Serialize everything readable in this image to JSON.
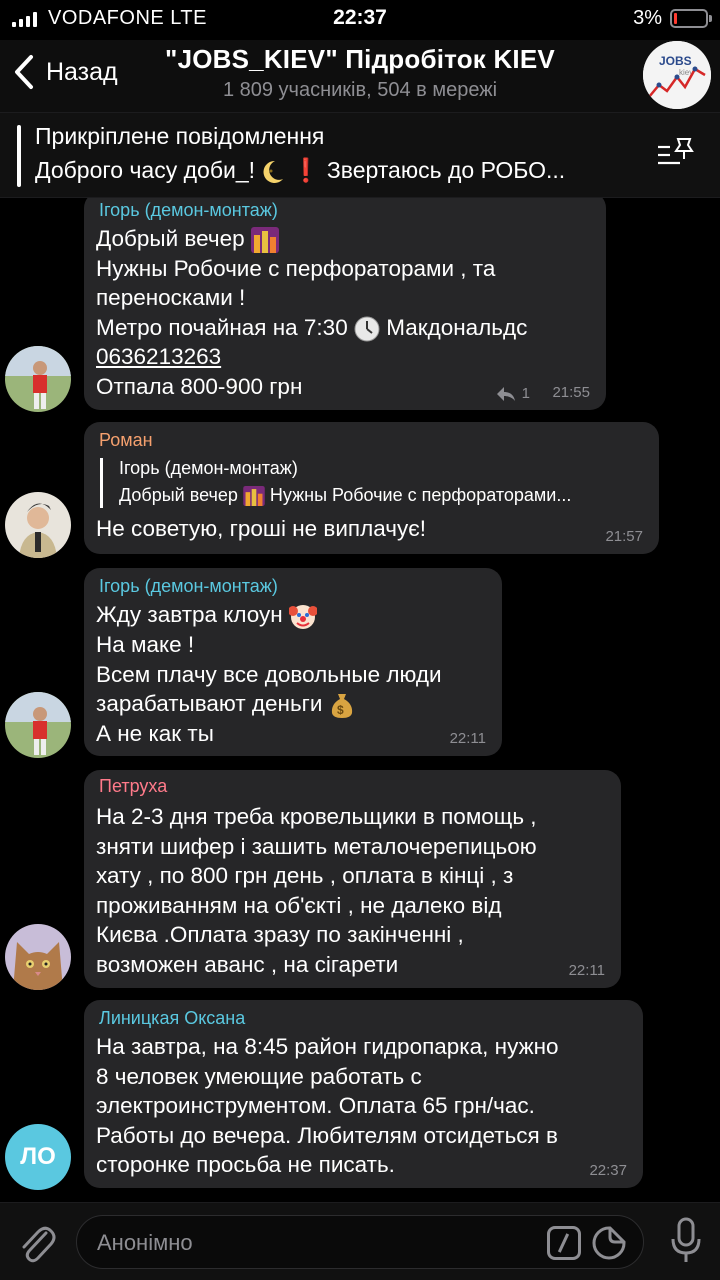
{
  "status_bar": {
    "carrier": "VODAFONE  LTE",
    "time": "22:37",
    "battery": "3%",
    "battery_level": 0.03
  },
  "header": {
    "back_label": "Назад",
    "title": "\"JOBS_KIEV\" Підробіток KIEV",
    "subtitle": "1 809 учасників, 504 в мережі"
  },
  "pinned": {
    "title": "Прикріплене повідомлення",
    "text_a": "Доброго часу доби_! ",
    "text_b": " ❗ Звертаюсь до РОБО..."
  },
  "colors": {
    "bubble": "#262628",
    "sender_teal": "#5ac8e0",
    "sender_orange": "#f5a06e",
    "sender_pink": "#ff7a8a",
    "avatar_lo": "#5ac8e0"
  },
  "messages": [
    {
      "sender": "Ігорь (демон-монтаж)",
      "line1": "Добрый вечер ",
      "line2": "Нужны Робочие с перфораторами , та\nпереносками !\nМетро почайная на 7:30 ",
      "line3": " Макдональдс",
      "phone": "0636213263",
      "line4": "Отпала 800-900 грн",
      "replies": "1",
      "time": "21:55"
    },
    {
      "sender": "Роман",
      "quote_name": "Ігорь (демон-монтаж)",
      "quote_text_a": "Добрый вечер ",
      "quote_text_b": "  Нужны Робочие с перфораторами...",
      "text": "Не советую, гроші не виплачує!",
      "time": "21:57"
    },
    {
      "sender": "Ігорь (демон-монтаж)",
      "line1": "Жду завтра клоун ",
      "line2": "На маке !\nВсем плачу все довольные люди\nзарабатывают деньги ",
      "line3": "А не как ты",
      "time": "22:11"
    },
    {
      "sender": "Петруха",
      "text": "На 2-3  дня треба кровельщики в помощь ,\nзняти шифер і зашить металочерепицьою\nхату , по 800 грн день , оплата в кінці , з\nпроживанням на об'єкті , не далеко від\nКиєва .Оплата зразу по закінченні ,\nвозможен аванс , на сігарети",
      "time": "22:11"
    },
    {
      "sender": "Линицкая Оксана",
      "text": "На завтра, на 8:45 район гидропарка, нужно\n8 человек умеющие работать с\nэлектроинструментом. Оплата 65 грн/час.\nРаботы до вечера. Любителям отсидеться в\nсторонке просьба не писать.",
      "time": "22:37",
      "avatar_initials": "ЛО"
    }
  ],
  "input": {
    "placeholder": "Анонімно"
  }
}
